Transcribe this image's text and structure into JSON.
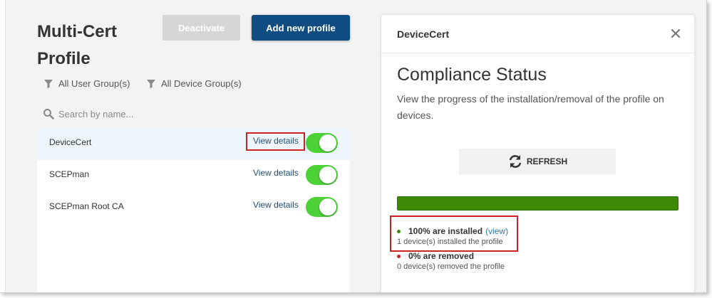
{
  "left": {
    "title": "Multi-Cert Profile",
    "deactivate_label": "Deactivate",
    "add_label": "Add new profile",
    "filters": [
      "All User Group(s)",
      "All Device Group(s)"
    ],
    "search_placeholder": "Search by name...",
    "profiles": [
      {
        "name": "DeviceCert",
        "action": "View details",
        "enabled": true,
        "selected": true
      },
      {
        "name": "SCEPman",
        "action": "View details",
        "enabled": true,
        "selected": false
      },
      {
        "name": "SCEPman Root CA",
        "action": "View details",
        "enabled": true,
        "selected": false
      }
    ]
  },
  "panel": {
    "title": "DeviceCert",
    "close_icon": "close-icon",
    "heading": "Compliance Status",
    "description": "View the progress of the installation/removal of the profile on devices.",
    "refresh_label": "REFRESH",
    "progress": 1.0,
    "progress_color": "#3d8a06",
    "installed": {
      "label": "100% are installed",
      "link": "(view)",
      "detail": "1 device(s) installed the profile",
      "color": "#3d8a06"
    },
    "removed": {
      "label": "0% are removed",
      "detail": "0 device(s) removed the profile",
      "color": "#cc2222"
    }
  },
  "colors": {
    "primary": "#0f4c81",
    "toggle_on": "#4cd137",
    "highlight": "#cc2222"
  }
}
